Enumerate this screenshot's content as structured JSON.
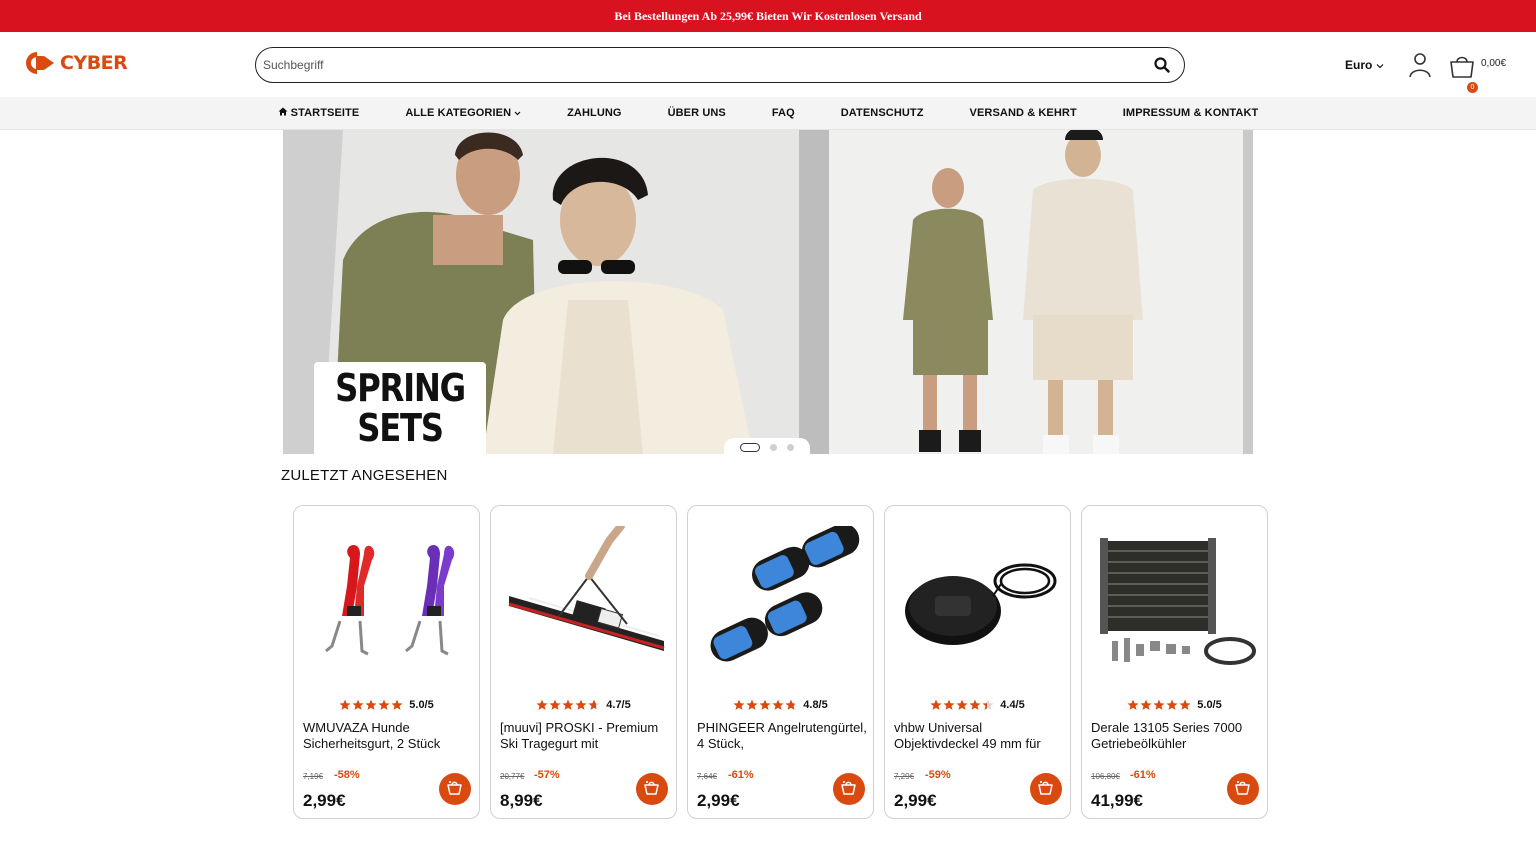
{
  "promo": {
    "text": "Bei Bestellungen Ab 25,99€ Bieten Wir Kostenlosen Versand"
  },
  "header": {
    "logo_text": "CYBER",
    "search_placeholder": "Suchbegriff",
    "currency": "Euro",
    "cart_count": "0",
    "cart_total": "0,00€"
  },
  "nav": {
    "items": [
      {
        "label": "STARTSEITE",
        "icon": "home-icon"
      },
      {
        "label": "ALLE KATEGORIEN",
        "icon": "chevron-down-icon"
      },
      {
        "label": "ZAHLUNG"
      },
      {
        "label": "ÜBER UNS"
      },
      {
        "label": "FAQ"
      },
      {
        "label": "DATENSCHUTZ"
      },
      {
        "label": "VERSAND & KEHRT"
      },
      {
        "label": "IMPRESSUM & KONTAKT"
      }
    ]
  },
  "hero": {
    "badge_line1": "SPRING",
    "badge_line2": "SETS",
    "slide_count": 3,
    "active_slide": 1
  },
  "recent": {
    "title": "ZULETZT ANGESEHEN",
    "products": [
      {
        "rating": "5.0/5",
        "rating_value": 5.0,
        "title": "WMUVAZA Hunde Sicherheitsgurt, 2 Stück",
        "old_price": "7,19€",
        "discount": "-58%",
        "price": "2,99€",
        "image": "dog-seatbelt"
      },
      {
        "rating": "4.7/5",
        "rating_value": 4.7,
        "title": "[muuvi] PROSKI - Premium Ski Tragegurt mit",
        "old_price": "20,77€",
        "discount": "-57%",
        "price": "8,99€",
        "image": "ski-strap"
      },
      {
        "rating": "4.8/5",
        "rating_value": 4.8,
        "title": "PHINGEER Angelrutengürtel, 4 Stück,",
        "old_price": "7,64€",
        "discount": "-61%",
        "price": "2,99€",
        "image": "rod-belts"
      },
      {
        "rating": "4.4/5",
        "rating_value": 4.4,
        "title": "vhbw Universal Objektivdeckel 49 mm für",
        "old_price": "7,29€",
        "discount": "-59%",
        "price": "2,99€",
        "image": "lens-cap"
      },
      {
        "rating": "5.0/5",
        "rating_value": 5.0,
        "title": "Derale 13105 Series 7000 Getriebeölkühler",
        "old_price": "106,80€",
        "discount": "-61%",
        "price": "41,99€",
        "image": "oil-cooler"
      }
    ]
  },
  "colors": {
    "promo_bg": "#d9121f",
    "accent": "#d94a10",
    "star": "#d94a10"
  }
}
